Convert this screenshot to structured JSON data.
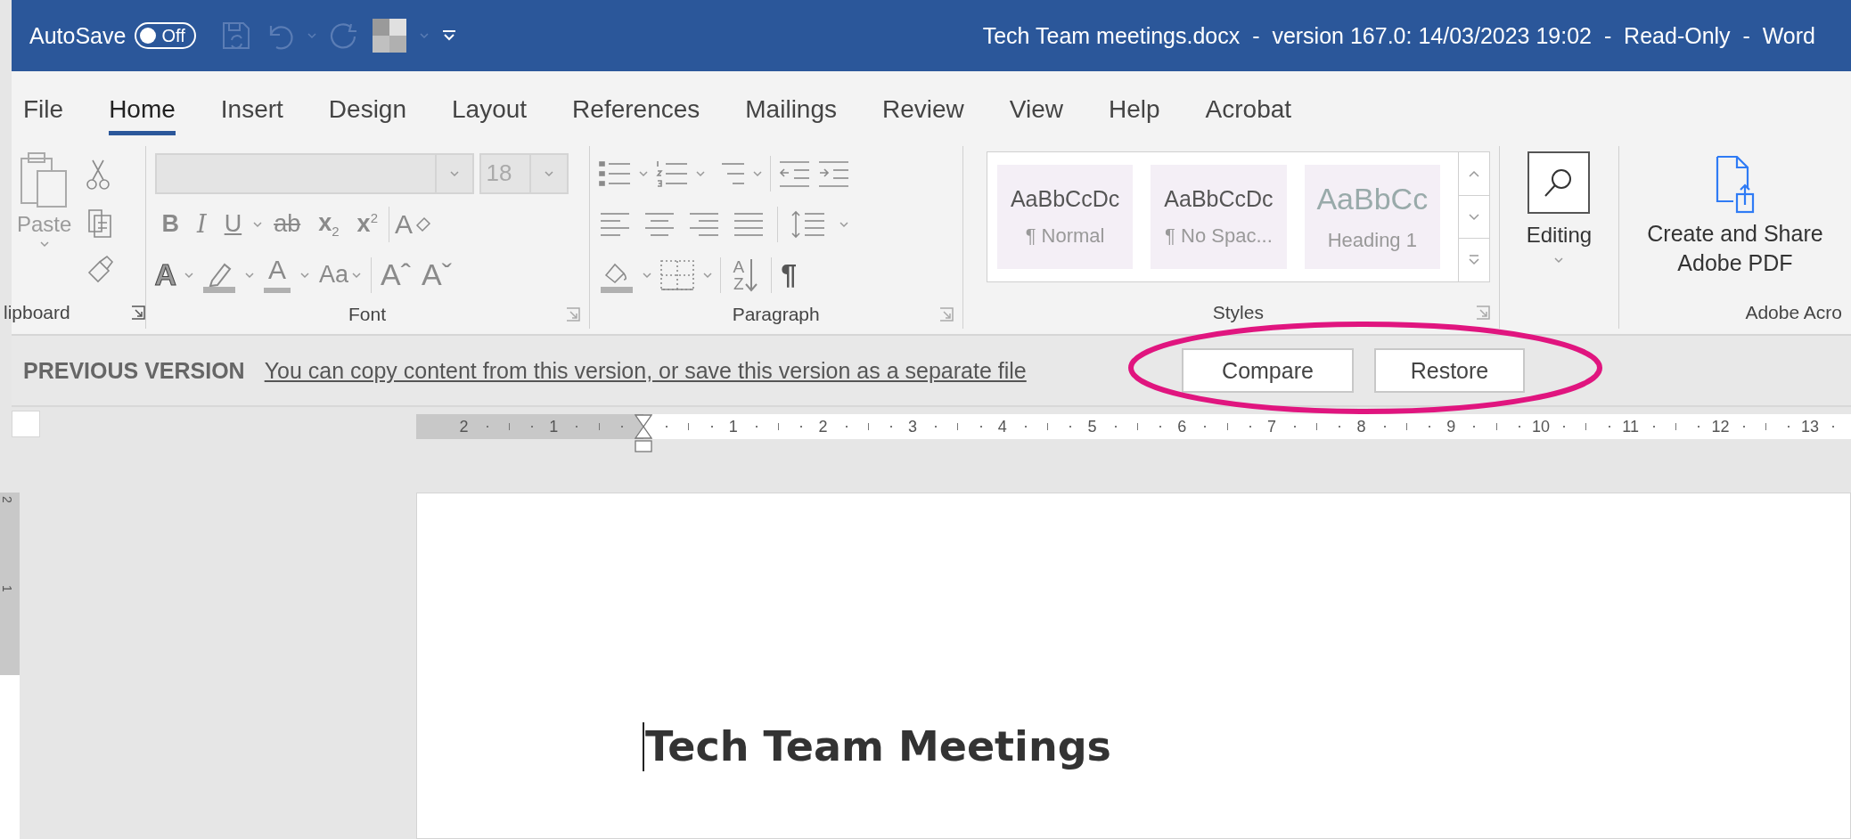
{
  "title_bar": {
    "autosave_label": "AutoSave",
    "autosave_toggle": {
      "label": "Off",
      "on": false
    },
    "title": "Tech Team meetings.docx  -  version 167.0: 14/03/2023 19:02  -  Read-Only  -  Word"
  },
  "tabs": [
    {
      "label": "File",
      "selected": false
    },
    {
      "label": "Home",
      "selected": true
    },
    {
      "label": "Insert",
      "selected": false
    },
    {
      "label": "Design",
      "selected": false
    },
    {
      "label": "Layout",
      "selected": false
    },
    {
      "label": "References",
      "selected": false
    },
    {
      "label": "Mailings",
      "selected": false
    },
    {
      "label": "Review",
      "selected": false
    },
    {
      "label": "View",
      "selected": false
    },
    {
      "label": "Help",
      "selected": false
    },
    {
      "label": "Acrobat",
      "selected": false
    }
  ],
  "ribbon": {
    "clipboard": {
      "paste": "Paste",
      "label": "lipboard"
    },
    "font": {
      "size": "18",
      "label": "Font",
      "format_buttons": [
        {
          "text": "B",
          "kind": "bold"
        },
        {
          "text": "I",
          "kind": "italic"
        },
        {
          "text": "U",
          "kind": "underline"
        },
        {
          "text": "ab",
          "kind": "strike"
        },
        {
          "text": "x$_{2}$",
          "kind": "script"
        },
        {
          "text": "x$^{2}$",
          "kind": "script"
        }
      ],
      "clear_letter": "A",
      "effects_letter": "A",
      "color_letter": "A",
      "change_case": "Aa",
      "grow": "Aˆ",
      "shrink": "Aˇ"
    },
    "paragraph": {
      "label": "Paragraph",
      "sort_letters": [
        "A",
        "Z"
      ],
      "marks": "¶"
    },
    "styles": {
      "label": "Styles",
      "items": [
        {
          "preview": "AaBbCcDc",
          "name": "¶ Normal",
          "kind": "body"
        },
        {
          "preview": "AaBbCcDc",
          "name": "¶ No Spac...",
          "kind": "body"
        },
        {
          "preview": "AaBbCc",
          "name": "Heading 1",
          "kind": "heading"
        }
      ]
    },
    "editing": {
      "label": "Editing"
    },
    "adobe": {
      "button": "Create and Share Adobe PDF",
      "label": "Adobe Acro"
    }
  },
  "info_bar": {
    "title": "PREVIOUS VERSION",
    "message": "You can copy content from this version, or save this version as a separate file",
    "buttons": [
      "Compare",
      "Restore"
    ]
  },
  "ruler": {
    "negative": [
      "2",
      "1"
    ],
    "positive": [
      "1",
      "2",
      "3",
      "4",
      "5",
      "6",
      "7",
      "8",
      "9",
      "10",
      "11",
      "12",
      "13"
    ]
  },
  "vertical_ruler": [
    "2",
    "1"
  ],
  "document": {
    "heading": "Tech Team Meetings"
  }
}
